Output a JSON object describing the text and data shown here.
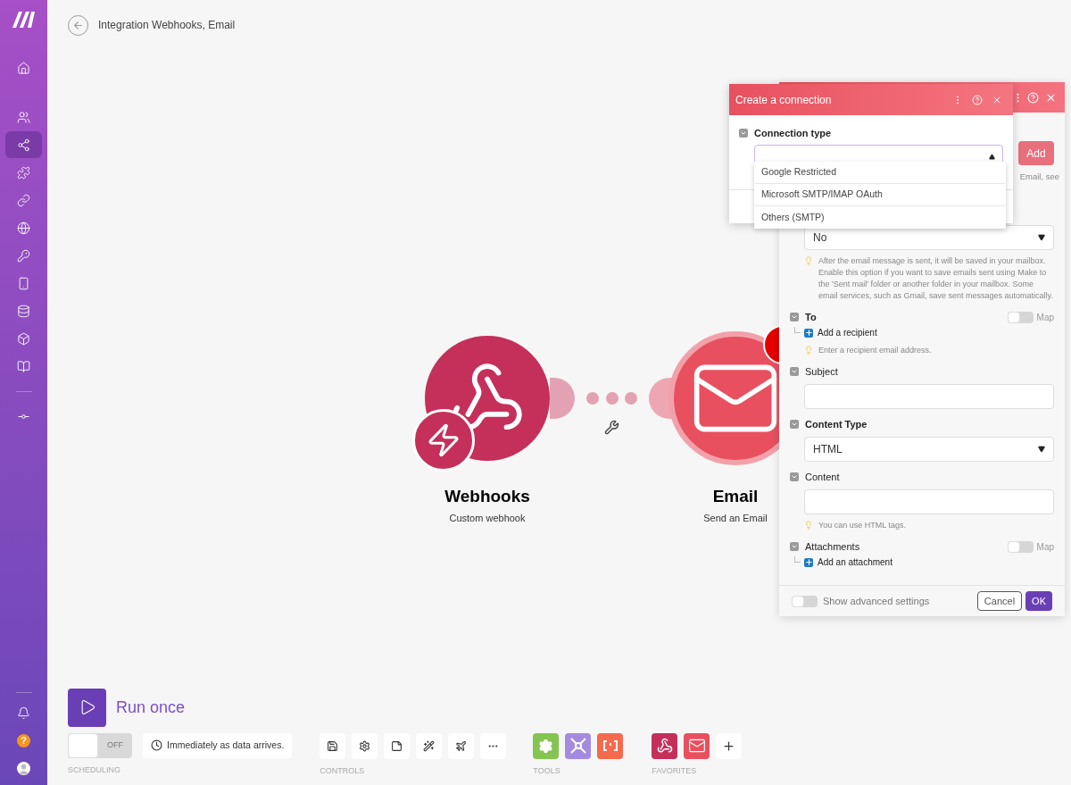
{
  "sidebar": {
    "items": [
      {
        "kind": "home",
        "selected": false
      },
      {
        "kind": "users",
        "selected": false
      },
      {
        "kind": "share",
        "selected": true
      },
      {
        "kind": "puzzle",
        "selected": false
      },
      {
        "kind": "link",
        "selected": false
      },
      {
        "kind": "globe",
        "selected": false
      },
      {
        "kind": "key",
        "selected": false
      },
      {
        "kind": "phone",
        "selected": false
      },
      {
        "kind": "database",
        "selected": false
      },
      {
        "kind": "box",
        "selected": false
      },
      {
        "kind": "book",
        "selected": false
      },
      {
        "kind": "divider"
      },
      {
        "kind": "commit",
        "selected": false
      }
    ],
    "help": "?"
  },
  "header": {
    "title": "Integration Webhooks, Email"
  },
  "nodes": [
    {
      "kind": "webhooks",
      "title": "Webhooks",
      "subtitle": "Custom webhook"
    },
    {
      "kind": "email",
      "title": "Email",
      "subtitle": "Send an Email"
    }
  ],
  "module_panel": {
    "connection": {
      "button": "Add",
      "hint": "Email, see"
    },
    "fields": [
      {
        "kind": "select",
        "value": "No",
        "hint": "After the email message is sent, it will be saved in your mailbox. Enable this option if you want to save emails sent using Make to the 'Sent mail' folder or another folder in your mailbox. Some email services, such as Gmail, save sent messages automatically."
      },
      {
        "kind": "array",
        "label": "To",
        "required": true,
        "map": false,
        "map_label": "Map",
        "add": "Add a recipient",
        "hint": "Enter a recipient email address."
      },
      {
        "kind": "text",
        "label": "Subject",
        "required": false
      },
      {
        "kind": "select",
        "label": "Content Type",
        "required": true,
        "value": "HTML"
      },
      {
        "kind": "text",
        "label": "Content",
        "required": false,
        "hint": "You can use HTML tags."
      },
      {
        "kind": "array",
        "label": "Attachments",
        "required": false,
        "map": false,
        "map_label": "Map",
        "add": "Add an attachment"
      }
    ],
    "advanced": {
      "label": "Show advanced settings",
      "on": false
    },
    "buttons": [
      "Cancel",
      "OK"
    ]
  },
  "connection_dialog": {
    "title": "Create a connection",
    "field": {
      "label": "Connection type",
      "required": true,
      "expanded": true
    },
    "options": [
      "Google Restricted",
      "Microsoft SMTP/IMAP OAuth",
      "Others (SMTP)"
    ]
  },
  "toolbar": {
    "run": "Run once",
    "scheduling": {
      "on": false,
      "toggle_label": "OFF",
      "schedule": "Immediately as data arrives.",
      "caption": "SCHEDULING"
    },
    "controls_caption": "CONTROLS",
    "tools_caption": "TOOLS",
    "favorites_caption": "FAVORITES"
  }
}
